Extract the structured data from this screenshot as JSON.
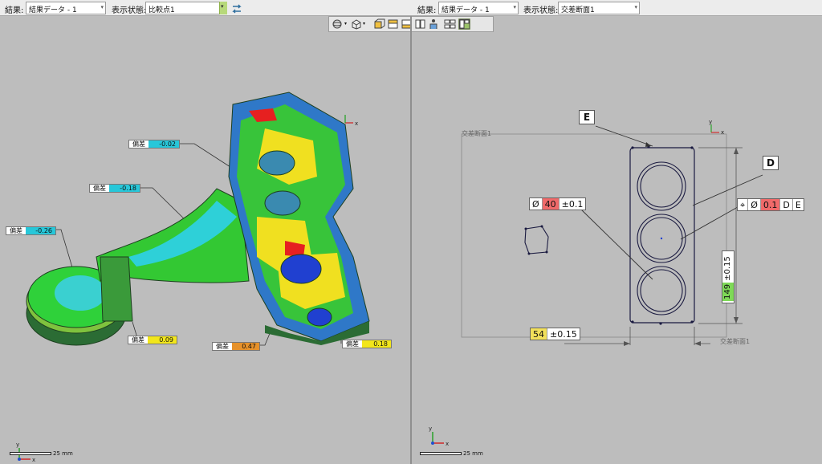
{
  "toolbar": {
    "left_result_label": "結果:",
    "left_result_value": "結果データ - 1",
    "left_display_label": "表示状態:",
    "left_display_value": "比較点1",
    "right_result_label": "結果:",
    "right_result_value": "結果データ - 1",
    "right_display_label": "表示状態:",
    "right_display_value": "交差断面1"
  },
  "left_panel": {
    "deviation_tags": [
      {
        "label": "偏差",
        "value": "-0.02",
        "color": "#27c7d9"
      },
      {
        "label": "偏差",
        "value": "-0.18",
        "color": "#27c7d9"
      },
      {
        "label": "偏差",
        "value": "-0.26",
        "color": "#27c7d9"
      },
      {
        "label": "偏差",
        "value": "0.09",
        "color": "#f2e61b"
      },
      {
        "label": "偏差",
        "value": "0.47",
        "color": "#e6912a"
      },
      {
        "label": "偏差",
        "value": "0.18",
        "color": "#f2e61b"
      }
    ],
    "scale_text": "25 mm"
  },
  "right_panel": {
    "section_name_top": "交差断面1",
    "section_name_bottom": "交差断面1",
    "datum_e": "E",
    "datum_d": "D",
    "dia_symbol": "Ø",
    "dia_value": "40",
    "dia_tol": "±0.1",
    "pos_symbol": "⌖",
    "pos_dia_symbol": "Ø",
    "pos_value": "0.1",
    "pos_datum_1": "D",
    "pos_datum_2": "E",
    "height_value": "149",
    "height_tol": "±0.15",
    "width_value": "54",
    "width_tol": "±0.15",
    "scale_text": "25 mm"
  },
  "colors": {
    "cyan_dev": "#27c7d9",
    "yellow_dev": "#f2e61b",
    "orange_dev": "#e6912a",
    "highlight_red": "#f06a6a",
    "highlight_green": "#7ed957",
    "highlight_yellow": "#f2e05a"
  }
}
